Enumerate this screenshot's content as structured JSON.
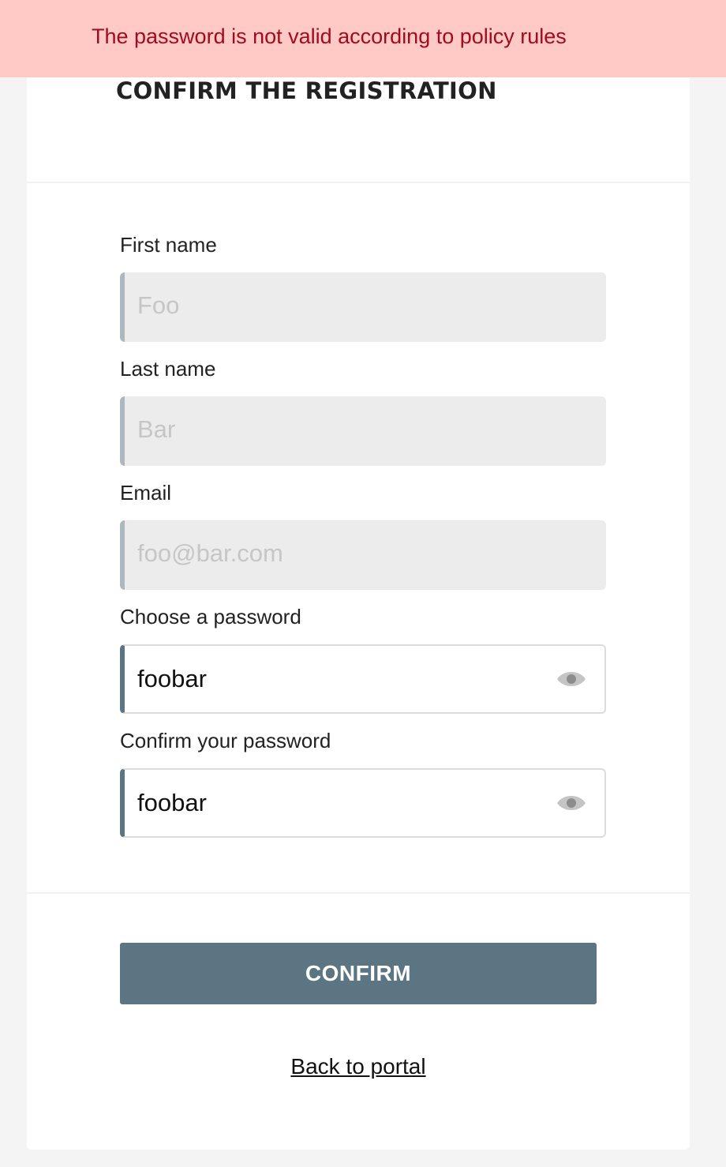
{
  "alert": {
    "message": "The password is not valid according to policy rules",
    "colors": {
      "background": "#ffc9c6",
      "text": "#a20b1e"
    }
  },
  "page": {
    "title": "CONFIRM THE REGISTRATION"
  },
  "form": {
    "first_name": {
      "label": "First name",
      "placeholder": "Foo"
    },
    "last_name": {
      "label": "Last name",
      "placeholder": "Bar"
    },
    "email": {
      "label": "Email",
      "placeholder": "foo@bar.com"
    },
    "password": {
      "label": "Choose a password",
      "value": "foobar",
      "toggle_icon": "eye-icon"
    },
    "confirm_password": {
      "label": "Confirm your password",
      "value": "foobar",
      "toggle_icon": "eye-icon"
    }
  },
  "actions": {
    "confirm_label": "CONFIRM",
    "back_label": "Back to portal"
  },
  "colors": {
    "accent": "#5b7582",
    "page_background": "#f4f4f4",
    "disabled_input": "#ececec"
  }
}
